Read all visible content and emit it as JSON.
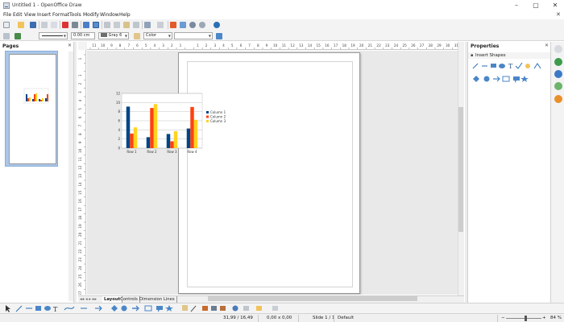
{
  "window": {
    "title": "Untitled 1 - OpenOffice Draw",
    "minimize": "–",
    "restore": "▢",
    "close": "✕"
  },
  "menu": [
    "File",
    "Edit",
    "View",
    "Insert",
    "Format",
    "Tools",
    "Modify",
    "Window",
    "Help"
  ],
  "close_doc_glyph": "✕",
  "toolbar2": {
    "line_width": "0.00 cm",
    "line_color": "Gray 6",
    "area_style": "Color",
    "area_value": ""
  },
  "pages_panel": {
    "title": "Pages",
    "close_glyph": "✕"
  },
  "rulers": {
    "horizontal_labels": [
      "11",
      "10",
      "9",
      "8",
      "7",
      "6",
      "5",
      "4",
      "3",
      "2",
      "1",
      "",
      "1",
      "2",
      "3",
      "4",
      "5",
      "6",
      "7",
      "8",
      "9",
      "10",
      "11",
      "12",
      "13",
      "14",
      "15",
      "16",
      "17",
      "18",
      "19",
      "20",
      "21",
      "22",
      "23",
      "24",
      "25",
      "26",
      "27",
      "28",
      "29",
      "30",
      "31",
      "32"
    ],
    "vertical_labels": [
      "1",
      "",
      "1",
      "2",
      "3",
      "4",
      "5",
      "6",
      "7",
      "8",
      "9",
      "10",
      "11",
      "12",
      "13",
      "14",
      "15",
      "16",
      "17",
      "18",
      "19",
      "20",
      "21",
      "22",
      "23",
      "24",
      "25",
      "26",
      "27",
      "28"
    ]
  },
  "chart_data": {
    "type": "bar",
    "categories": [
      "Row 1",
      "Row 2",
      "Row 3",
      "Row 4"
    ],
    "series": [
      {
        "name": "Column 1",
        "values": [
          9.1,
          2.4,
          3.1,
          4.3
        ],
        "color": "#004586"
      },
      {
        "name": "Column 2",
        "values": [
          3.2,
          8.8,
          1.5,
          9.02
        ],
        "color": "#ff420e"
      },
      {
        "name": "Column 3",
        "values": [
          4.54,
          9.65,
          3.7,
          6.2
        ],
        "color": "#ffd320"
      }
    ],
    "y_ticks": [
      "0",
      "2",
      "4",
      "6",
      "8",
      "10",
      "12"
    ],
    "ylim": [
      0,
      12
    ],
    "grid": true,
    "legend": "right"
  },
  "sheet_tabs": [
    "Layout",
    "Controls",
    "Dimension Lines"
  ],
  "properties_panel": {
    "title": "Properties",
    "close_glyph": "✕",
    "section_label": "Insert Shapes",
    "section_toggle": "▪"
  },
  "status": {
    "position": "31,99 / 16,49",
    "size": "0,00 x 0,00",
    "slide": "Slide 1 / 1",
    "layout": "Default",
    "zoom": "84 %",
    "zoom_fraction": 0.55
  },
  "colors": {
    "accent_blue": "#2a6fb5",
    "thumb_selection": "#a9c7e8",
    "canvas_bg": "#e9e9e9"
  }
}
